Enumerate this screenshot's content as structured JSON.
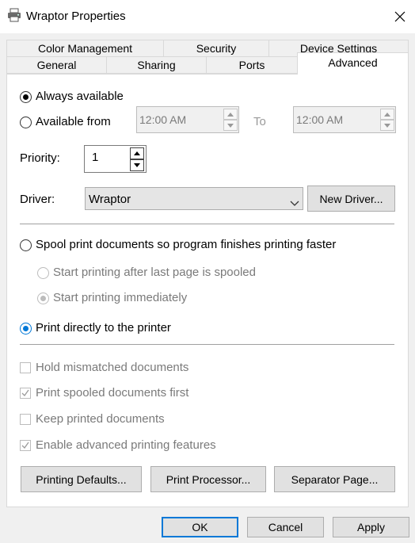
{
  "window": {
    "title": "Wraptor Properties"
  },
  "tabs_top": [
    "Color Management",
    "Security",
    "Device Settings"
  ],
  "tabs_bottom": [
    "General",
    "Sharing",
    "Ports",
    "Advanced"
  ],
  "availability": {
    "always_label": "Always available",
    "from_label": "Available from",
    "from_time": "12:00 AM",
    "to_label": "To",
    "to_time": "12:00 AM",
    "selected": "always"
  },
  "priority": {
    "label": "Priority:",
    "value": "1"
  },
  "driver": {
    "label": "Driver:",
    "value": "Wraptor",
    "new_driver_label": "New Driver..."
  },
  "spool": {
    "spool_label": "Spool print documents so program finishes printing faster",
    "after_last_page_label": "Start printing after last page is spooled",
    "immediately_label": "Start printing immediately",
    "direct_label": "Print directly to the printer",
    "selected": "direct"
  },
  "options": [
    {
      "label": "Hold mismatched documents",
      "checked": false
    },
    {
      "label": "Print spooled documents first",
      "checked": true
    },
    {
      "label": "Keep printed documents",
      "checked": false
    },
    {
      "label": "Enable advanced printing features",
      "checked": true
    }
  ],
  "panel_buttons": {
    "printing_defaults": "Printing Defaults...",
    "print_processor": "Print Processor...",
    "separator_page": "Separator Page..."
  },
  "dialog_buttons": {
    "ok": "OK",
    "cancel": "Cancel",
    "apply": "Apply"
  },
  "colors": {
    "accent": "#0078d7",
    "disabled_text": "#7a7a7a"
  }
}
